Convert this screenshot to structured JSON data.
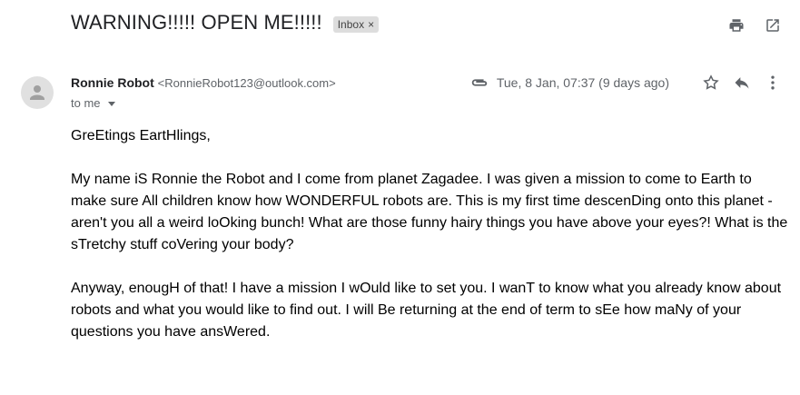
{
  "email": {
    "subject": "WARNING!!!!! OPEN ME!!!!!",
    "label": "Inbox",
    "label_close": "×",
    "sender_name": "Ronnie Robot",
    "sender_email": "<RonnieRobot123@outlook.com>",
    "recipient": "to me",
    "date": "Tue, 8 Jan, 07:37 (9 days ago)",
    "paragraphs": [
      "GreEtings EartHlings,",
      "My name iS Ronnie the Robot and I come from planet Zagadee. I was given a mission to come to Earth to make sure All children know how WONDERFUL robots are. This is my first time descenDing onto this planet - aren't you all a weird loOking bunch! What are those funny hairy things you have above your eyes?! What is the sTretchy stuff coVering your body?",
      "Anyway, enougH of that! I have a mission I wOuld like to set you. I wanT to know what you already know about robots and what you would like to find out. I will Be returning at the end of term to sEe how maNy of your questions you have ansWered."
    ]
  },
  "icons": {
    "print": "print-icon",
    "open_in_new": "open-in-new-icon",
    "attachment": "attachment-icon",
    "star": "star-icon",
    "reply": "reply-icon",
    "more": "more-vert-icon",
    "avatar": "person-icon"
  },
  "colors": {
    "text": "#202124",
    "muted": "#5f6368",
    "chip": "#dddddd"
  }
}
